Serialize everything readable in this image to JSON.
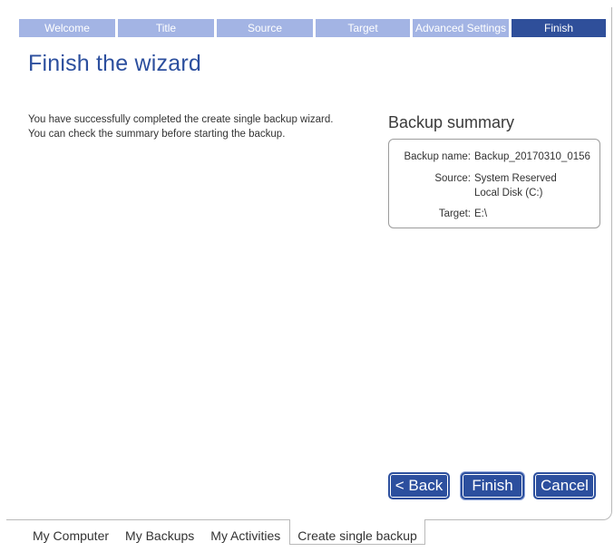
{
  "steps": [
    "Welcome",
    "Title",
    "Source",
    "Target",
    "Advanced Settings",
    "Finish"
  ],
  "active_step": "Finish",
  "page_title": "Finish the wizard",
  "description": {
    "line1": "You have successfully completed the create single backup wizard.",
    "line2": "You can check the summary before starting the backup."
  },
  "summary": {
    "heading": "Backup summary",
    "backup_name_label": "Backup name:",
    "backup_name_value": "Backup_20170310_0156",
    "source_label": "Source:",
    "source_value_1": "System Reserved",
    "source_value_2": "Local Disk (C:)",
    "target_label": "Target:",
    "target_value": "E:\\"
  },
  "buttons": {
    "back": "< Back",
    "finish": "Finish",
    "cancel": "Cancel"
  },
  "bottom_tabs": [
    "My Computer",
    "My Backups",
    "My Activities",
    "Create single backup"
  ],
  "active_tab": "Create single backup",
  "colors": {
    "accent": "#2c4f9e",
    "step_inactive": "#a3b4e4",
    "step_active": "#2f4f9a"
  }
}
